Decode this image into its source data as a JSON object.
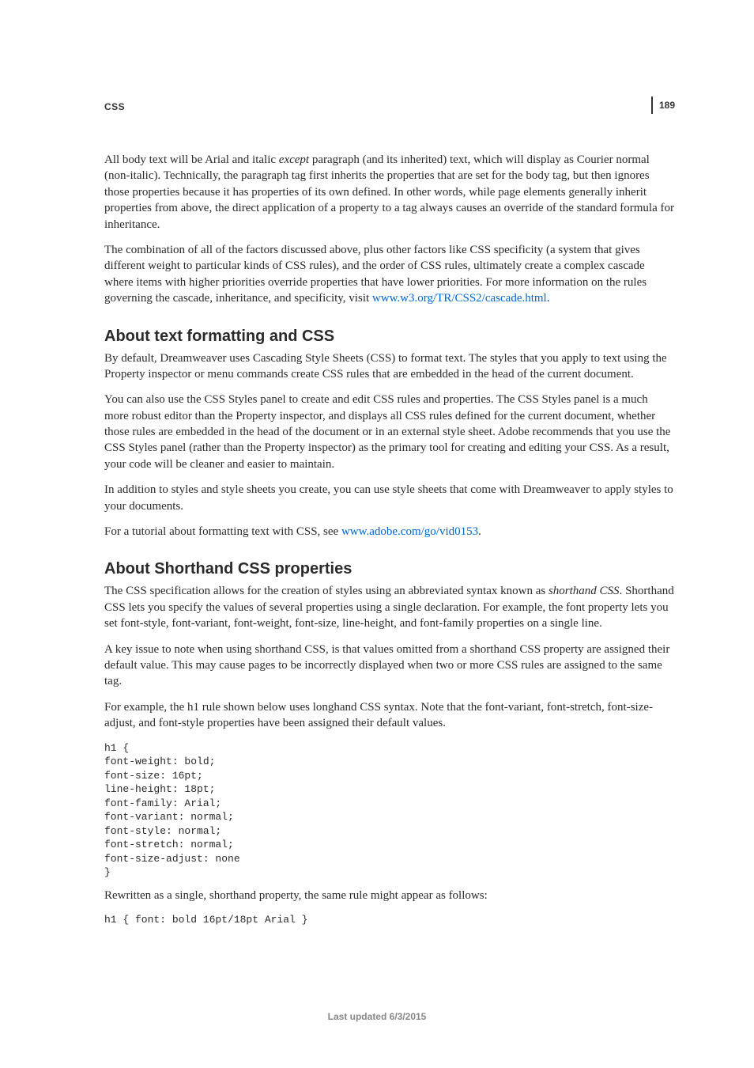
{
  "header": {
    "section_label": "CSS",
    "page_number": "189"
  },
  "paragraphs": {
    "intro_a_1": "All body text will be Arial and italic ",
    "intro_a_em": "except",
    "intro_a_2": " paragraph (and its inherited) text, which will display as Courier normal (non-italic). Technically, the paragraph tag first inherits the properties that are set for the body tag, but then ignores those properties because it has properties of its own defined. In other words, while page elements generally inherit properties from above, the direct application of a property to a tag always causes an override of the standard formula for inheritance.",
    "intro_b_1": "The combination of all of the factors discussed above, plus other factors like CSS specificity (a system that gives different weight to particular kinds of CSS rules), and the order of CSS rules, ultimately create a complex cascade where items with higher priorities override properties that have lower priorities. For more information on the rules governing the cascade, inheritance, and specificity, visit ",
    "intro_b_link": "www.w3.org/TR/CSS2/cascade.html",
    "intro_b_2": "."
  },
  "section1": {
    "heading": "About text formatting and CSS",
    "p1": "By default, Dreamweaver uses Cascading Style Sheets (CSS) to format text. The styles that you apply to text using the Property inspector or menu commands create CSS rules that are embedded in the head of the current document.",
    "p2": "You can also use the CSS Styles panel to create and edit CSS rules and properties. The CSS Styles panel is a much more robust editor than the Property inspector, and displays all CSS rules defined for the current document, whether those rules are embedded in the head of the document or in an external style sheet. Adobe recommends that you use the CSS Styles panel (rather than the Property inspector) as the primary tool for creating and editing your CSS. As a result, your code will be cleaner and easier to maintain.",
    "p3": "In addition to styles and style sheets you create, you can use style sheets that come with Dreamweaver to apply styles to your documents.",
    "p4_1": "For a tutorial about formatting text with CSS, see ",
    "p4_link": "www.adobe.com/go/vid0153",
    "p4_2": "."
  },
  "section2": {
    "heading": "About Shorthand CSS properties",
    "p1_1": "The CSS specification allows for the creation of styles using an abbreviated syntax known as ",
    "p1_em": "shorthand CSS",
    "p1_2": ". Shorthand CSS lets you specify the values of several properties using a single declaration. For example, the font property lets you set font-style, font-variant, font-weight, font-size, line-height, and font-family properties on a single line.",
    "p2": "A key issue to note when using shorthand CSS, is that values omitted from a shorthand CSS property are assigned their default value. This may cause pages to be incorrectly displayed when two or more CSS rules are assigned to the same tag.",
    "p3": "For example, the h1 rule shown below uses longhand CSS syntax. Note that the font-variant, font-stretch, font-size-adjust, and font-style properties have been assigned their default values.",
    "code1": "h1 { \nfont-weight: bold; \nfont-size: 16pt; \nline-height: 18pt; \nfont-family: Arial; \nfont-variant: normal; \nfont-style: normal; \nfont-stretch: normal; \nfont-size-adjust: none \n}",
    "p4": "Rewritten as a single, shorthand property, the same rule might appear as follows:",
    "code2": "h1 { font: bold 16pt/18pt Arial }"
  },
  "footer": {
    "last_updated": "Last updated 6/3/2015"
  }
}
